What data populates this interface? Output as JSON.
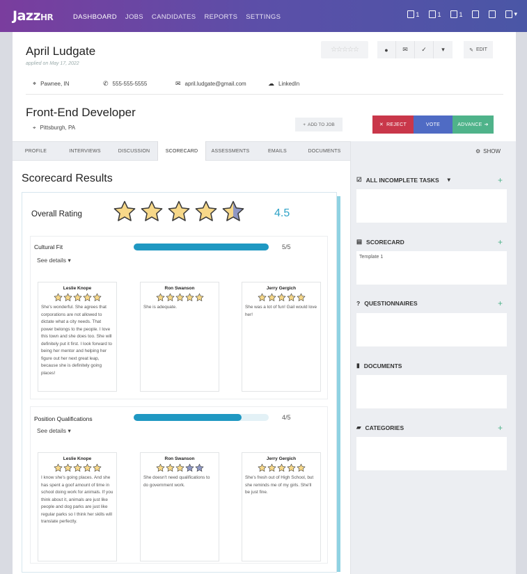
{
  "nav": {
    "logo": "Jazz",
    "logo_sub": "HR",
    "links": [
      "DASHBOARD",
      "JOBS",
      "CANDIDATES",
      "REPORTS",
      "SETTINGS"
    ],
    "icon_counts": [
      "1",
      "1",
      "1"
    ]
  },
  "candidate": {
    "name": "April Ludgate",
    "applied": "applied on May 17, 2022",
    "edit_label": "EDIT",
    "location": "Pawnee, IN",
    "phone": "555-555-5555",
    "email": "april.ludgate@gmail.com",
    "linkedin": "LinkedIn",
    "rating_stars": "☆☆☆☆☆"
  },
  "job": {
    "title": "Front-End Developer",
    "location": "Pittsburgh, PA",
    "add_to_job": "ADD TO JOB",
    "reject": "REJECT",
    "vote": "VOTE",
    "advance": "ADVANCE"
  },
  "tabs": [
    "PROFILE",
    "INTERVIEWS",
    "DISCUSSION",
    "SCORECARD",
    "ASSESSMENTS",
    "EMAILS",
    "DOCUMENTS"
  ],
  "sidebar": {
    "show": "SHOW",
    "sections": [
      {
        "title": "ALL INCOMPLETE TASKS",
        "content": ""
      },
      {
        "title": "SCORECARD",
        "content": "Template 1"
      },
      {
        "title": "QUESTIONNAIRES",
        "content": ""
      },
      {
        "title": "DOCUMENTS",
        "content": ""
      },
      {
        "title": "CATEGORIES",
        "content": ""
      }
    ]
  },
  "scorecard": {
    "title": "Scorecard Results",
    "overall_label": "Overall Rating",
    "overall_value": "4.5",
    "categories": [
      {
        "name": "Cultural Fit",
        "score": "5/5",
        "fraction": 1.0,
        "see_details": "See details",
        "reviews": [
          {
            "name": "Leslie Knope",
            "stars": 5,
            "text": "She's wonderful. She agrees that corporations are not allowed to dictate what a city needs. That power belongs to the people. I love this town and she does too. She will definitely put it first. I look forward to being her mentor and helping her figure out her next great leap, because she is definitely going places!"
          },
          {
            "name": "Ron Swanson",
            "stars": 5,
            "text": "She is adequate."
          },
          {
            "name": "Jerry Gergich",
            "stars": 5,
            "text": "She was a lot of fun! Gail would love her!"
          }
        ]
      },
      {
        "name": "Position Qualifications",
        "score": "4/5",
        "fraction": 0.8,
        "see_details": "See details",
        "reviews": [
          {
            "name": "Leslie Knope",
            "stars": 5,
            "text": "I know she's going places. And she has spent a goof amount of time in school doing work for animals. If you think about it, animals are just like people and dog parks are just like regular parks so I think her skills will translate perfectly."
          },
          {
            "name": "Ron Swanson",
            "stars": 3,
            "text": "She doesn't need qualifications to do government work."
          },
          {
            "name": "Jerry Gergich",
            "stars": 5,
            "text": "She's fresh out of High School, but she reminds me of my girls. She'll be just fine."
          }
        ]
      }
    ]
  },
  "colors": {
    "star_fill": "#f7d889",
    "star_empty": "#8e97c4",
    "bar_fill": "#1f98c2",
    "reject": "#c9374a",
    "vote": "#4f6bc4",
    "advance": "#4fb38a"
  }
}
